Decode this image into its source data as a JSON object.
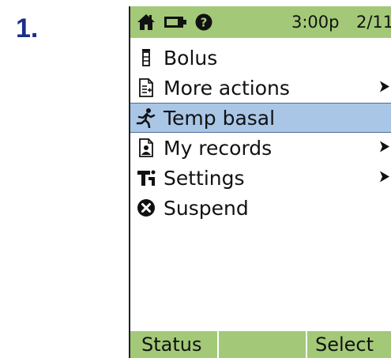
{
  "step": {
    "number": "1."
  },
  "status_bar": {
    "icons": [
      "home-icon",
      "battery-icon",
      "help-icon"
    ],
    "time": "3:00p",
    "page": "2/11"
  },
  "menu": {
    "items": [
      {
        "label": "Bolus",
        "icon": "bolus-vial-icon",
        "has_submenu": false,
        "selected": false
      },
      {
        "label": "More actions",
        "icon": "more-actions-icon",
        "has_submenu": true,
        "selected": false
      },
      {
        "label": "Temp basal",
        "icon": "temp-basal-runner-icon",
        "has_submenu": false,
        "selected": true
      },
      {
        "label": "My records",
        "icon": "my-records-icon",
        "has_submenu": true,
        "selected": false
      },
      {
        "label": "Settings",
        "icon": "settings-icon",
        "has_submenu": true,
        "selected": false
      },
      {
        "label": "Suspend",
        "icon": "suspend-icon",
        "has_submenu": false,
        "selected": false
      }
    ]
  },
  "soft_keys": {
    "left": "Status",
    "middle": "",
    "right": "Select"
  },
  "colors": {
    "bar_green": "#a3c978",
    "selection_blue": "#a9c6e6",
    "step_blue": "#1a2e8c"
  }
}
